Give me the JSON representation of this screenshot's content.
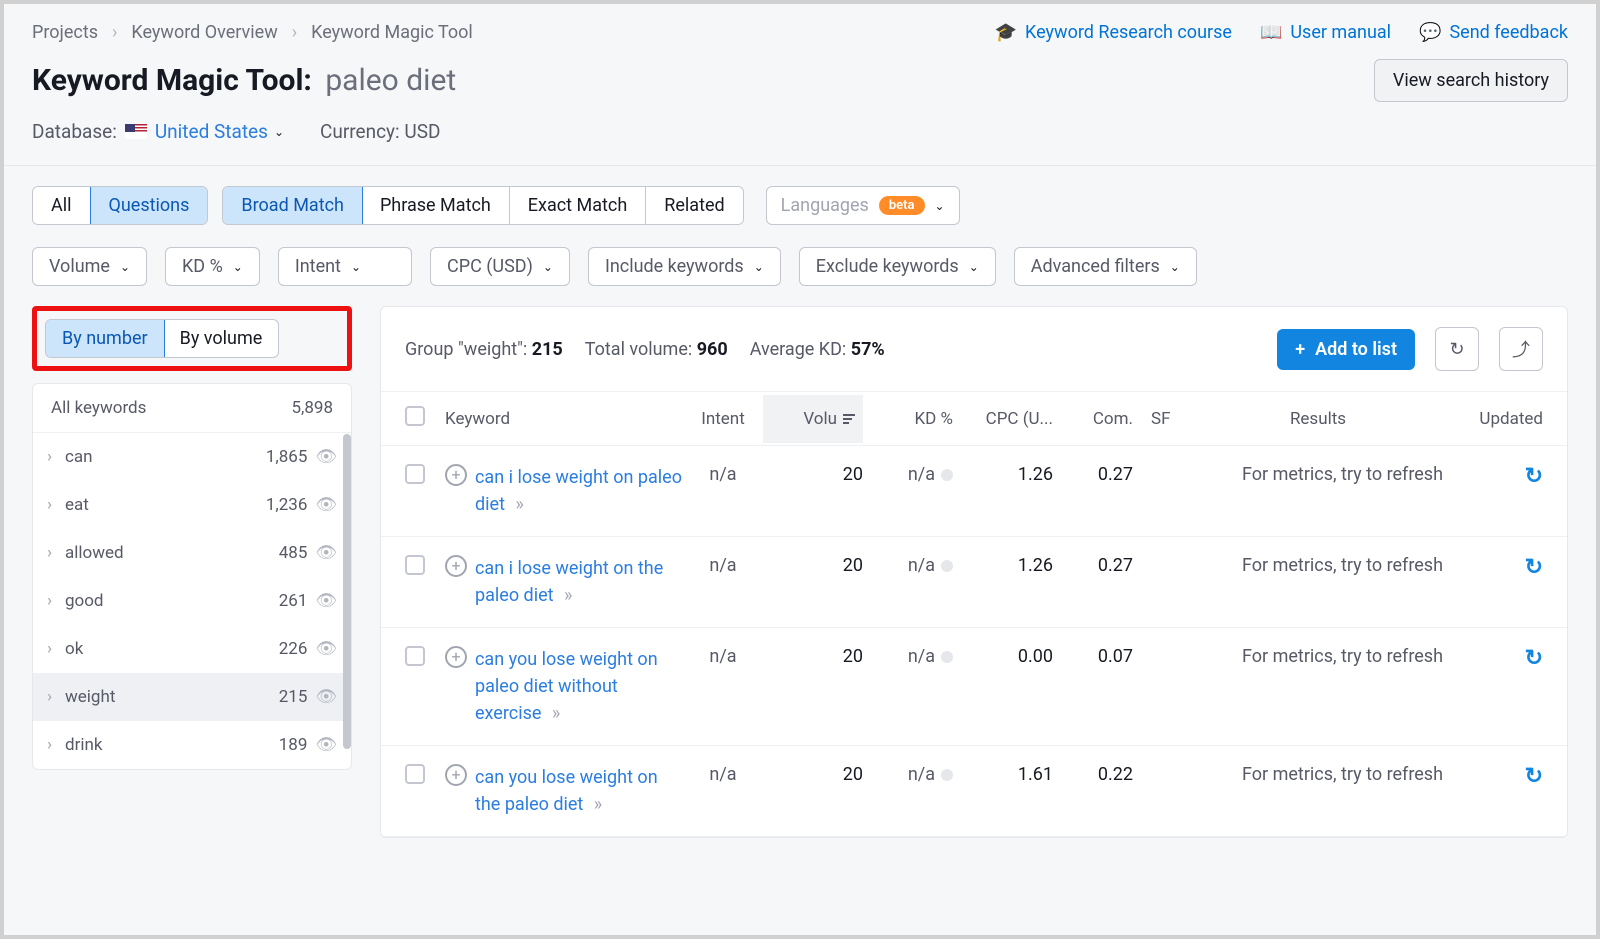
{
  "breadcrumbs": [
    "Projects",
    "Keyword Overview",
    "Keyword Magic Tool"
  ],
  "top_links": {
    "course": "Keyword Research course",
    "manual": "User manual",
    "feedback": "Send feedback"
  },
  "title": {
    "prefix": "Keyword Magic Tool:",
    "keyword": "paleo diet"
  },
  "view_history": "View search history",
  "meta": {
    "database_label": "Database:",
    "database": "United States",
    "currency_label": "Currency:",
    "currency": "USD"
  },
  "tabs": {
    "all": "All",
    "questions": "Questions"
  },
  "match": {
    "broad": "Broad Match",
    "phrase": "Phrase Match",
    "exact": "Exact Match",
    "related": "Related"
  },
  "languages": {
    "label": "Languages",
    "badge": "beta"
  },
  "filters": {
    "volume": "Volume",
    "kd": "KD %",
    "intent": "Intent",
    "cpc": "CPC (USD)",
    "include": "Include keywords",
    "exclude": "Exclude keywords",
    "advanced": "Advanced filters"
  },
  "sort": {
    "by_number": "By number",
    "by_volume": "By volume"
  },
  "sidebar": {
    "all_label": "All keywords",
    "all_count": "5,898",
    "groups": [
      {
        "name": "can",
        "count": "1,865"
      },
      {
        "name": "eat",
        "count": "1,236"
      },
      {
        "name": "allowed",
        "count": "485"
      },
      {
        "name": "good",
        "count": "261"
      },
      {
        "name": "ok",
        "count": "226"
      },
      {
        "name": "weight",
        "count": "215",
        "active": true
      },
      {
        "name": "drink",
        "count": "189"
      }
    ]
  },
  "group_header": {
    "group_label": "Group \"weight\":",
    "group_count": "215",
    "total_label": "Total volume:",
    "total": "960",
    "kd_label": "Average KD:",
    "kd": "57%",
    "add": "Add to list"
  },
  "columns": {
    "keyword": "Keyword",
    "intent": "Intent",
    "volume": "Volu",
    "kd": "KD %",
    "cpc": "CPC (U...",
    "com": "Com.",
    "sf": "SF",
    "results": "Results",
    "updated": "Updated"
  },
  "rows": [
    {
      "keyword": "can i lose weight on paleo diet",
      "intent": "n/a",
      "volume": "20",
      "kd": "n/a",
      "cpc": "1.26",
      "com": "0.27",
      "results": "For metrics, try to refresh"
    },
    {
      "keyword": "can i lose weight on the paleo diet",
      "intent": "n/a",
      "volume": "20",
      "kd": "n/a",
      "cpc": "1.26",
      "com": "0.27",
      "results": "For metrics, try to refresh"
    },
    {
      "keyword": "can you lose weight on paleo diet without exercise",
      "intent": "n/a",
      "volume": "20",
      "kd": "n/a",
      "cpc": "0.00",
      "com": "0.07",
      "results": "For metrics, try to refresh"
    },
    {
      "keyword": "can you lose weight on the paleo diet",
      "intent": "n/a",
      "volume": "20",
      "kd": "n/a",
      "cpc": "1.61",
      "com": "0.22",
      "results": "For metrics, try to refresh"
    }
  ]
}
